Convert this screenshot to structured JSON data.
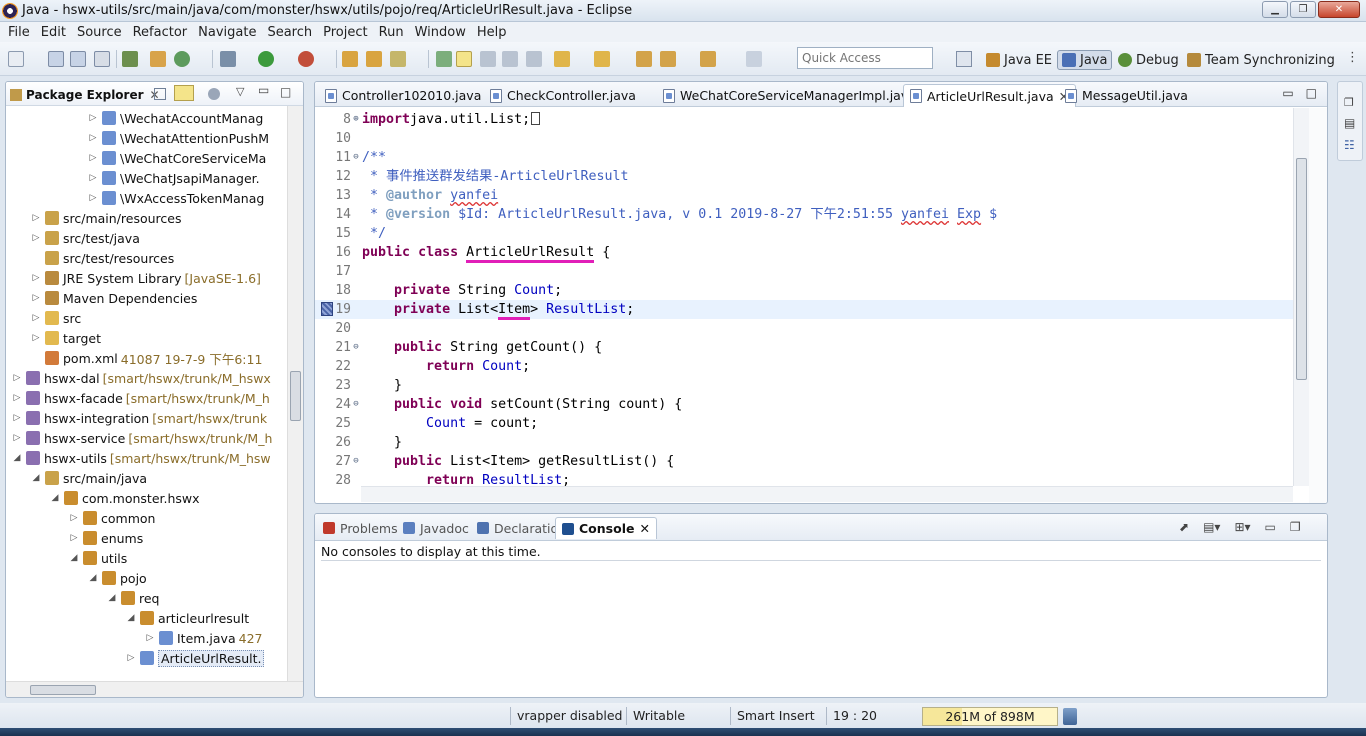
{
  "window": {
    "title": "Java - hswx-utils/src/main/java/com/monster/hswx/utils/pojo/req/ArticleUrlResult.java - Eclipse",
    "minimize_icon": "minimize-icon",
    "maximize_icon": "maximize-icon",
    "close_icon": "close-icon"
  },
  "menu": [
    "File",
    "Edit",
    "Source",
    "Refactor",
    "Navigate",
    "Search",
    "Project",
    "Run",
    "Window",
    "Help"
  ],
  "toolbar": {
    "quick_access_placeholder": "Quick Access",
    "perspectives": [
      {
        "label": "Java EE",
        "active": false,
        "color": "#c58a2e"
      },
      {
        "label": "Java",
        "active": true,
        "color": "#4a6fb5"
      },
      {
        "label": "Debug",
        "active": false,
        "color": "#5a8f3a"
      },
      {
        "label": "Team Synchronizing",
        "active": false,
        "color": "#b58a3c"
      }
    ]
  },
  "package_explorer": {
    "title": "Package Explorer",
    "close_glyph": "✕",
    "tree": [
      {
        "label": "\\WechatAccountManag",
        "deco": "",
        "indent": 5,
        "arrow": "▷",
        "icon": "java-file-icon"
      },
      {
        "label": "\\WechatAttentionPushM",
        "deco": "",
        "indent": 5,
        "arrow": "▷",
        "icon": "java-file-icon"
      },
      {
        "label": "\\WeChatCoreServiceMa",
        "deco": "",
        "indent": 5,
        "arrow": "▷",
        "icon": "java-file-icon"
      },
      {
        "label": "\\WeChatJsapiManager.",
        "deco": "",
        "indent": 5,
        "arrow": "▷",
        "icon": "java-file-icon"
      },
      {
        "label": "\\WxAccessTokenManag",
        "deco": "",
        "indent": 5,
        "arrow": "▷",
        "icon": "java-file-icon"
      },
      {
        "label": "src/main/resources",
        "deco": "",
        "indent": 2,
        "arrow": "▷",
        "icon": "source-folder-icon"
      },
      {
        "label": "src/test/java",
        "deco": "",
        "indent": 2,
        "arrow": "▷",
        "icon": "source-folder-icon"
      },
      {
        "label": "src/test/resources",
        "deco": "",
        "indent": 2,
        "arrow": "",
        "icon": "source-folder-icon"
      },
      {
        "label": "JRE System Library",
        "deco": "[JavaSE-1.6]",
        "indent": 2,
        "arrow": "▷",
        "icon": "library-icon"
      },
      {
        "label": "Maven Dependencies",
        "deco": "",
        "indent": 2,
        "arrow": "▷",
        "icon": "library-icon"
      },
      {
        "label": "src",
        "deco": "",
        "indent": 2,
        "arrow": "▷",
        "icon": "folder-icon"
      },
      {
        "label": "target",
        "deco": "",
        "indent": 2,
        "arrow": "▷",
        "icon": "folder-icon"
      },
      {
        "label": "pom.xml",
        "deco": "41087  19-7-9 下午6:11",
        "indent": 2,
        "arrow": "",
        "icon": "xml-file-icon"
      },
      {
        "label": "hswx-dal",
        "deco": "[smart/hswx/trunk/M_hswx",
        "indent": 1,
        "arrow": "▷",
        "icon": "project-icon"
      },
      {
        "label": "hswx-facade",
        "deco": "[smart/hswx/trunk/M_h",
        "indent": 1,
        "arrow": "▷",
        "icon": "project-icon"
      },
      {
        "label": "hswx-integration",
        "deco": "[smart/hswx/trunk",
        "indent": 1,
        "arrow": "▷",
        "icon": "project-icon"
      },
      {
        "label": "hswx-service",
        "deco": "[smart/hswx/trunk/M_h",
        "indent": 1,
        "arrow": "▷",
        "icon": "project-icon"
      },
      {
        "label": "hswx-utils",
        "deco": "[smart/hswx/trunk/M_hsw",
        "indent": 1,
        "arrow": "◢",
        "icon": "project-icon"
      },
      {
        "label": "src/main/java",
        "deco": "",
        "indent": 2,
        "arrow": "◢",
        "icon": "source-folder-icon"
      },
      {
        "label": "com.monster.hswx",
        "deco": "",
        "indent": 3,
        "arrow": "◢",
        "icon": "package-icon"
      },
      {
        "label": "common",
        "deco": "",
        "indent": 4,
        "arrow": "▷",
        "icon": "package-icon"
      },
      {
        "label": "enums",
        "deco": "",
        "indent": 4,
        "arrow": "▷",
        "icon": "package-icon"
      },
      {
        "label": "utils",
        "deco": "",
        "indent": 4,
        "arrow": "◢",
        "icon": "package-icon"
      },
      {
        "label": "pojo",
        "deco": "",
        "indent": 5,
        "arrow": "◢",
        "icon": "package-icon"
      },
      {
        "label": "req",
        "deco": "",
        "indent": 6,
        "arrow": "◢",
        "icon": "package-icon"
      },
      {
        "label": "articleurlresult",
        "deco": "",
        "indent": 7,
        "arrow": "◢",
        "icon": "package-icon"
      },
      {
        "label": "Item.java",
        "deco": "427",
        "indent": 8,
        "arrow": "▷",
        "icon": "java-file-icon"
      },
      {
        "label": "ArticleUrlResult.",
        "deco": "",
        "indent": 7,
        "arrow": "▷",
        "icon": "java-file-icon",
        "selected": true
      }
    ]
  },
  "editor": {
    "tabs": [
      {
        "label": "Controller102010.java",
        "active": false
      },
      {
        "label": "CheckController.java",
        "active": false
      },
      {
        "label": "WeChatCoreServiceManagerImpl.java",
        "active": false
      },
      {
        "label": "ArticleUrlResult.java",
        "active": true
      },
      {
        "label": "MessageUtil.java",
        "active": false
      }
    ],
    "tab_close_glyph": "✕",
    "current_line": "19",
    "lines": [
      {
        "no": "8",
        "fold": "⊕",
        "parts": [
          [
            "kw",
            "import"
          ],
          [
            "",
            "java.util.List;"
          ],
          [
            "box",
            ""
          ]
        ]
      },
      {
        "no": "10",
        "fold": "",
        "parts": []
      },
      {
        "no": "11",
        "fold": "⊖",
        "parts": [
          [
            "doc",
            "/**"
          ]
        ]
      },
      {
        "no": "12",
        "fold": "",
        "parts": [
          [
            "doc",
            " * 事件推送群发结果-ArticleUrlResult"
          ]
        ]
      },
      {
        "no": "13",
        "fold": "",
        "parts": [
          [
            "doc",
            " * "
          ],
          [
            "tag",
            "@author"
          ],
          [
            "doc",
            " "
          ],
          [
            "docsq",
            "yanfei"
          ]
        ]
      },
      {
        "no": "14",
        "fold": "",
        "parts": [
          [
            "doc",
            " * "
          ],
          [
            "tag",
            "@version"
          ],
          [
            "doc",
            " $Id: ArticleUrlResult.java, v 0.1 2019-8-27 下午2:51:55 "
          ],
          [
            "docsq",
            "yanfei"
          ],
          [
            "doc",
            " "
          ],
          [
            "docsq",
            "Exp"
          ],
          [
            "doc",
            " $"
          ]
        ]
      },
      {
        "no": "15",
        "fold": "",
        "parts": [
          [
            "doc",
            " */"
          ]
        ]
      },
      {
        "no": "16",
        "fold": "",
        "parts": [
          [
            "kw",
            "public"
          ],
          [
            "",
            " "
          ],
          [
            "kw",
            "class"
          ],
          [
            "",
            " "
          ],
          [
            "hl",
            "ArticleUrlResult"
          ],
          [
            "",
            " {"
          ]
        ]
      },
      {
        "no": "17",
        "fold": "",
        "parts": []
      },
      {
        "no": "18",
        "fold": "",
        "parts": [
          [
            "",
            "    "
          ],
          [
            "kw",
            "private"
          ],
          [
            "",
            " String "
          ],
          [
            "fld",
            "Count"
          ],
          [
            "",
            ";"
          ]
        ]
      },
      {
        "no": "19",
        "fold": "",
        "parts": [
          [
            "",
            "    "
          ],
          [
            "kw",
            "private"
          ],
          [
            "",
            " List<"
          ],
          [
            "hl",
            "Item"
          ],
          [
            "",
            "> "
          ],
          [
            "fld",
            "ResultList"
          ],
          [
            "",
            ";"
          ]
        ]
      },
      {
        "no": "20",
        "fold": "",
        "parts": []
      },
      {
        "no": "21",
        "fold": "⊖",
        "parts": [
          [
            "",
            "    "
          ],
          [
            "kw",
            "public"
          ],
          [
            "",
            " String getCount() {"
          ]
        ]
      },
      {
        "no": "22",
        "fold": "",
        "parts": [
          [
            "",
            "        "
          ],
          [
            "kw",
            "return"
          ],
          [
            "",
            " "
          ],
          [
            "fld",
            "Count"
          ],
          [
            "",
            ";"
          ]
        ]
      },
      {
        "no": "23",
        "fold": "",
        "parts": [
          [
            "",
            "    }"
          ]
        ]
      },
      {
        "no": "24",
        "fold": "⊖",
        "parts": [
          [
            "",
            "    "
          ],
          [
            "kw",
            "public"
          ],
          [
            "",
            " "
          ],
          [
            "kw",
            "void"
          ],
          [
            "",
            " setCount(String count) {"
          ]
        ]
      },
      {
        "no": "25",
        "fold": "",
        "parts": [
          [
            "",
            "        "
          ],
          [
            "fld",
            "Count"
          ],
          [
            "",
            " = count;"
          ]
        ]
      },
      {
        "no": "26",
        "fold": "",
        "parts": [
          [
            "",
            "    }"
          ]
        ]
      },
      {
        "no": "27",
        "fold": "⊖",
        "parts": [
          [
            "",
            "    "
          ],
          [
            "kw",
            "public"
          ],
          [
            "",
            " List<Item> getResultList() {"
          ]
        ]
      },
      {
        "no": "28",
        "fold": "",
        "parts": [
          [
            "",
            "        "
          ],
          [
            "kw",
            "return"
          ],
          [
            "",
            " "
          ],
          [
            "fld",
            "ResultList"
          ],
          [
            "",
            ";"
          ]
        ]
      }
    ]
  },
  "console": {
    "tabs": [
      {
        "label": "Problems",
        "active": false,
        "color": "#c0392b"
      },
      {
        "label": "Javadoc",
        "active": false,
        "color": "#5b7fbf"
      },
      {
        "label": "Declaration",
        "active": false,
        "color": "#4f73b0"
      },
      {
        "label": "Console",
        "active": true,
        "color": "#1f4f8f"
      }
    ],
    "message": "No consoles to display at this time."
  },
  "status": {
    "vrapper": "vrapper disabled",
    "writable": "Writable",
    "insert_mode": "Smart Insert",
    "position": "19 : 20",
    "heap": "261M of 898M",
    "heap_used_fraction": 0.29
  }
}
